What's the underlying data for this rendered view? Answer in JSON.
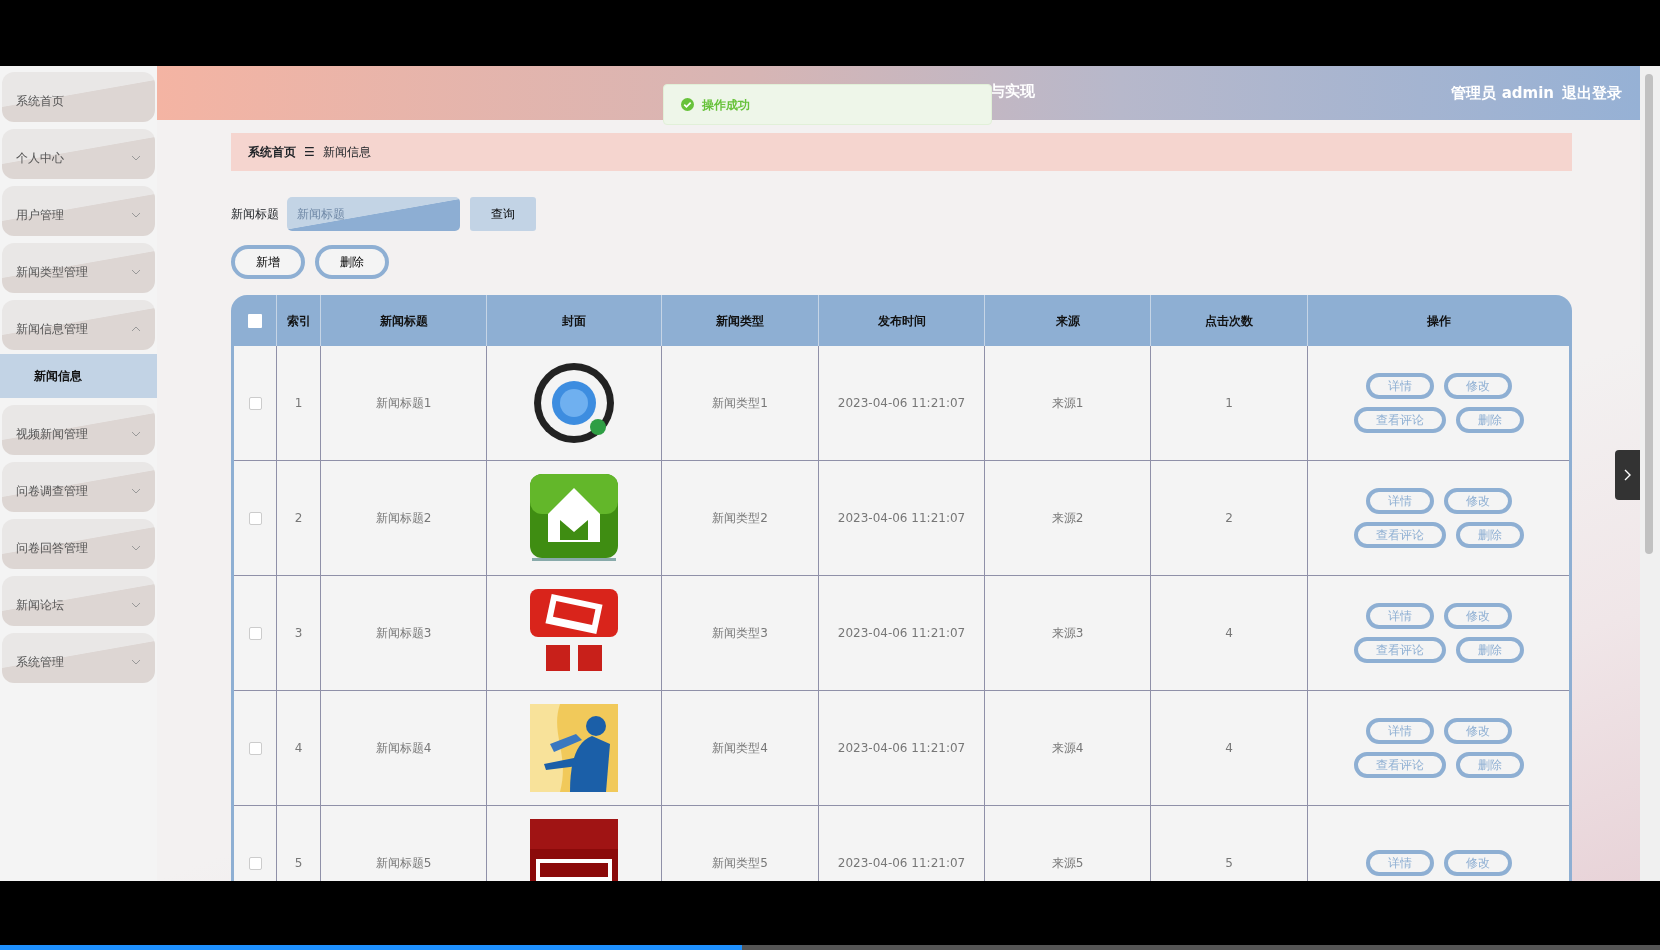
{
  "sidebar": {
    "items": [
      {
        "label": "系统首页",
        "kind": "link"
      },
      {
        "label": "个人中心",
        "kind": "menu",
        "expanded": false
      },
      {
        "label": "用户管理",
        "kind": "menu",
        "expanded": false
      },
      {
        "label": "新闻类型管理",
        "kind": "menu",
        "expanded": false
      },
      {
        "label": "新闻信息管理",
        "kind": "menu",
        "expanded": true,
        "children": [
          {
            "label": "新闻信息",
            "selected": true
          }
        ]
      },
      {
        "label": "视频新闻管理",
        "kind": "menu",
        "expanded": false
      },
      {
        "label": "问卷调查管理",
        "kind": "menu",
        "expanded": false
      },
      {
        "label": "问卷回答管理",
        "kind": "menu",
        "expanded": false
      },
      {
        "label": "新闻论坛",
        "kind": "menu",
        "expanded": false
      },
      {
        "label": "系统管理",
        "kind": "menu",
        "expanded": false
      }
    ]
  },
  "header": {
    "title": "与实现",
    "user": "管理员 admin",
    "logout": "退出登录"
  },
  "toast": {
    "message": "操作成功"
  },
  "breadcrumb": {
    "items": [
      "系统首页",
      "新闻信息"
    ],
    "separator": "☰"
  },
  "search": {
    "label": "新闻标题",
    "placeholder": "新闻标题",
    "button": "查询"
  },
  "toolbar": [
    "新增",
    "删除"
  ],
  "table": {
    "select_all": false,
    "columns": [
      "索引",
      "新闻标题",
      "封面",
      "新闻类型",
      "发布时间",
      "来源",
      "点击次数",
      "操作"
    ],
    "rows": [
      {
        "checked": false,
        "index": "1",
        "title": "新闻标题1",
        "type": "新闻类型1",
        "time": "2023-04-06 11:21:07",
        "source": "来源1",
        "clicks": "1",
        "actions": [
          "详情",
          "修改",
          "查看评论",
          "删除"
        ]
      },
      {
        "checked": false,
        "index": "2",
        "title": "新闻标题2",
        "type": "新闻类型2",
        "time": "2023-04-06 11:21:07",
        "source": "来源2",
        "clicks": "2",
        "actions": [
          "详情",
          "修改",
          "查看评论",
          "删除"
        ]
      },
      {
        "checked": false,
        "index": "3",
        "title": "新闻标题3",
        "type": "新闻类型3",
        "time": "2023-04-06 11:21:07",
        "source": "来源3",
        "clicks": "4",
        "actions": [
          "详情",
          "修改",
          "查看评论",
          "删除"
        ]
      },
      {
        "checked": false,
        "index": "4",
        "title": "新闻标题4",
        "type": "新闻类型4",
        "time": "2023-04-06 11:21:07",
        "source": "来源4",
        "clicks": "4",
        "actions": [
          "详情",
          "修改",
          "查看评论",
          "删除"
        ]
      },
      {
        "checked": false,
        "index": "5",
        "title": "新闻标题5",
        "type": "新闻类型5",
        "time": "2023-04-06 11:21:07",
        "source": "来源5",
        "clicks": "5",
        "actions": [
          "详情",
          "修改"
        ]
      }
    ]
  },
  "player": {
    "level": 0.447
  }
}
